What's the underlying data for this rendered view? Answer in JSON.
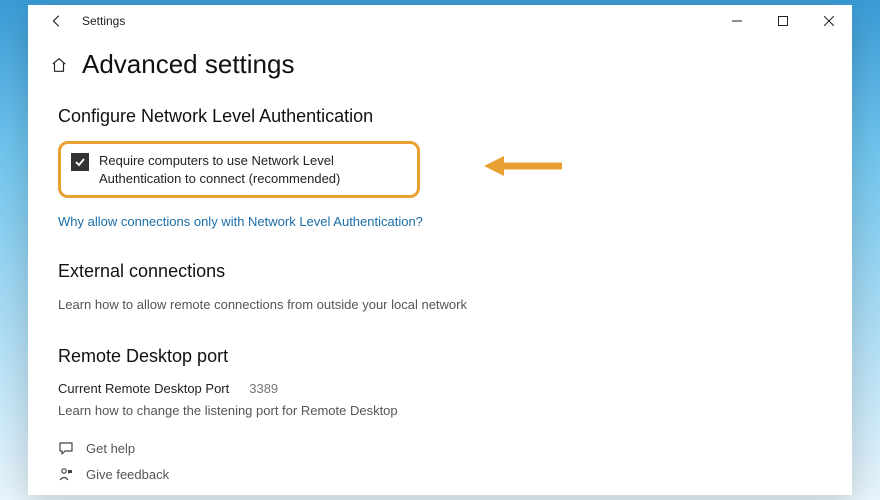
{
  "titlebar": {
    "label": "Settings"
  },
  "page": {
    "title": "Advanced settings"
  },
  "nla": {
    "heading": "Configure Network Level Authentication",
    "checkbox_label": "Require computers to use Network Level Authentication to connect (recommended)",
    "link": "Why allow connections only with Network Level Authentication?"
  },
  "external": {
    "heading": "External connections",
    "body": "Learn how to allow remote connections from outside your local network"
  },
  "port": {
    "heading": "Remote Desktop port",
    "label": "Current Remote Desktop Port",
    "value": "3389",
    "body": "Learn how to change the listening port for Remote Desktop"
  },
  "footer": {
    "help": "Get help",
    "feedback": "Give feedback"
  }
}
